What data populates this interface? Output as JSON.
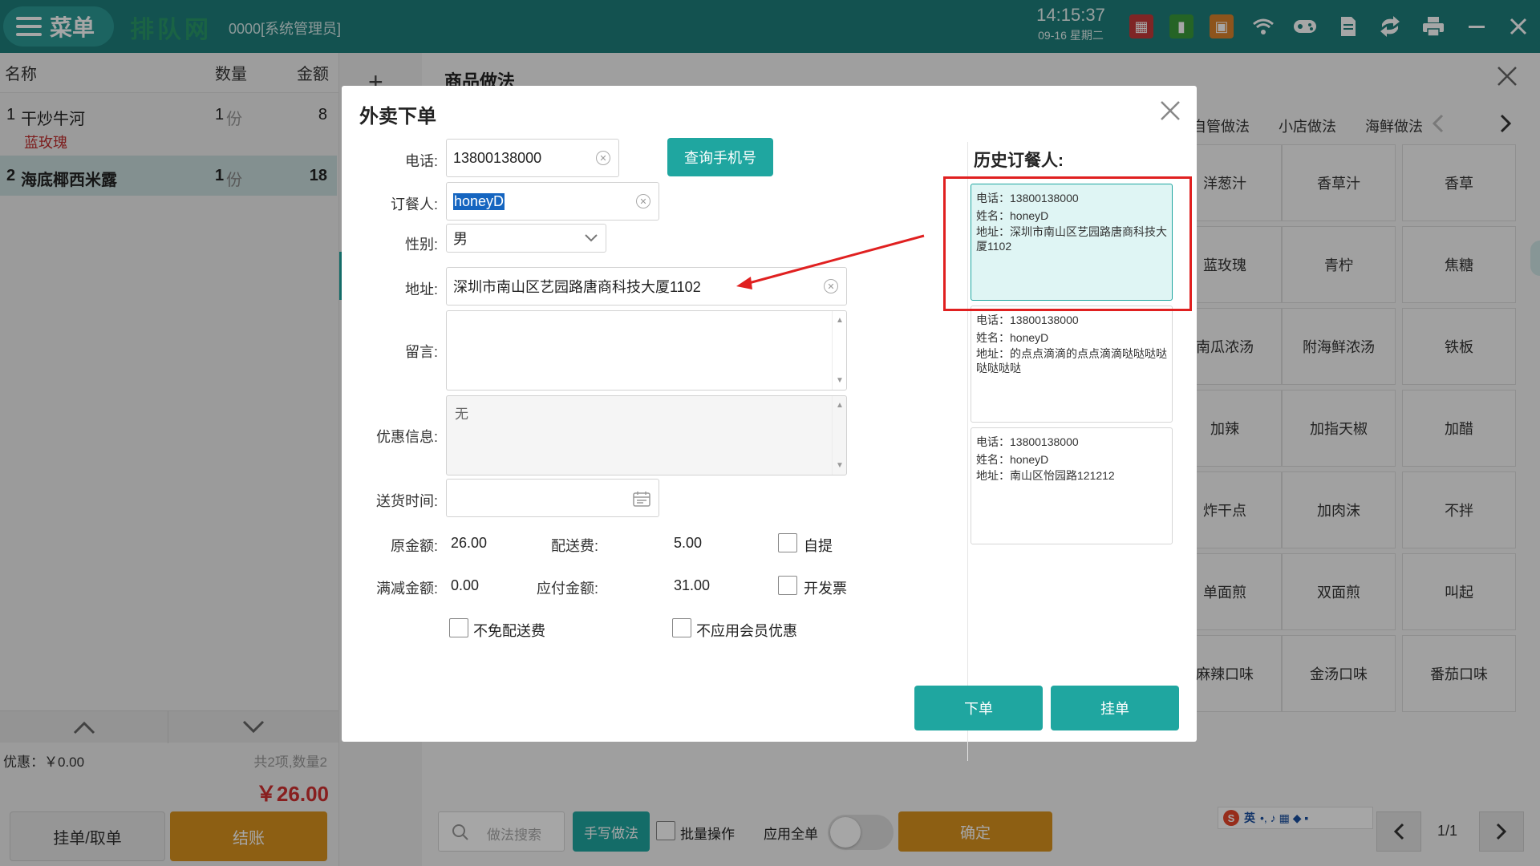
{
  "topbar": {
    "menu_label": "菜单",
    "logo_text": "排队网",
    "user": "0000[系统管理员]",
    "time": "14:15:37",
    "date": "09-16 星期二",
    "icons": [
      "store-icon",
      "battery-icon",
      "calendar-icon",
      "wifi-icon",
      "gamepad-icon",
      "document-icon",
      "sync-icon",
      "printer-icon",
      "minimize-icon",
      "close-icon"
    ]
  },
  "order_panel": {
    "columns": [
      "名称",
      "数量",
      "金额"
    ],
    "rows": [
      {
        "index": "1",
        "name": "干炒牛河",
        "qty": "1",
        "unit": "份",
        "amount": "8",
        "note": "蓝玫瑰"
      },
      {
        "index": "2",
        "name": "海底椰西米露",
        "qty": "1",
        "unit": "份",
        "amount": "18",
        "note": ""
      }
    ],
    "discount": "优惠：￥0.00",
    "summary": "共2项,数量2",
    "total": "￥26.00",
    "hold_button": "挂单/取单",
    "checkout_button": "结账"
  },
  "right_panel": {
    "add_icon": "+",
    "title": "商品做法",
    "tabs": [
      "自管做法",
      "小店做法",
      "海鲜做法"
    ],
    "grid": [
      [
        "洋葱汁",
        "香草汁",
        "香草"
      ],
      [
        "蓝玫瑰",
        "青柠",
        "焦糖"
      ],
      [
        "南瓜浓汤",
        "附海鲜浓汤",
        "铁板"
      ],
      [
        "加辣",
        "加指天椒",
        "加醋"
      ],
      [
        "炸干点",
        "加肉沫",
        "不拌"
      ],
      [
        "单面煎",
        "双面煎",
        "叫起"
      ],
      [
        "麻辣口味",
        "金汤口味",
        "番茄口味"
      ]
    ],
    "search_placeholder": "做法搜索",
    "handwrite_button": "手写做法",
    "batch_label": "批量操作",
    "apply_all_label": "应用全单",
    "confirm_button": "确定",
    "page": "1/1",
    "ime_text": "英"
  },
  "dialog": {
    "title": "外卖下单",
    "phone_label": "电话:",
    "phone_value": "13800138000",
    "query_button": "查询手机号",
    "orderer_label": "订餐人:",
    "orderer_value": "honeyD",
    "gender_label": "性别:",
    "gender_value": "男",
    "address_label": "地址:",
    "address_value": "深圳市南山区艺园路唐商科技大厦1102",
    "message_label": "留言:",
    "promo_label": "优惠信息:",
    "promo_value": "无",
    "delivery_label": "送货时间:",
    "original_label": "原金额:",
    "original_value": "26.00",
    "fee_label": "配送费:",
    "fee_value": "5.00",
    "pickup_label": "自提",
    "reduce_label": "满减金额:",
    "reduce_value": "0.00",
    "payable_label": "应付金额:",
    "payable_value": "31.00",
    "invoice_label": "开发票",
    "no_free_delivery_label": "不免配送费",
    "no_member_label": "不应用会员优惠",
    "place_order_button": "下单",
    "hold_button": "挂单",
    "history_title": "历史订餐人:",
    "history": [
      {
        "phone": "电话：13800138000",
        "name": "姓名：honeyD",
        "address": "地址：深圳市南山区艺园路唐商科技大厦1102"
      },
      {
        "phone": "电话：13800138000",
        "name": "姓名：honeyD",
        "address": "地址：的点点滴滴的点点滴滴哒哒哒哒哒哒哒哒"
      },
      {
        "phone": "电话：13800138000",
        "name": "姓名：honeyD",
        "address": "地址：南山区怡园路121212"
      }
    ]
  },
  "colors": {
    "teal": "#1fa6a0",
    "topbar": "#1e7e7b",
    "orange": "#d9921e",
    "red_total": "#d23030",
    "annotation": "#e02020"
  }
}
